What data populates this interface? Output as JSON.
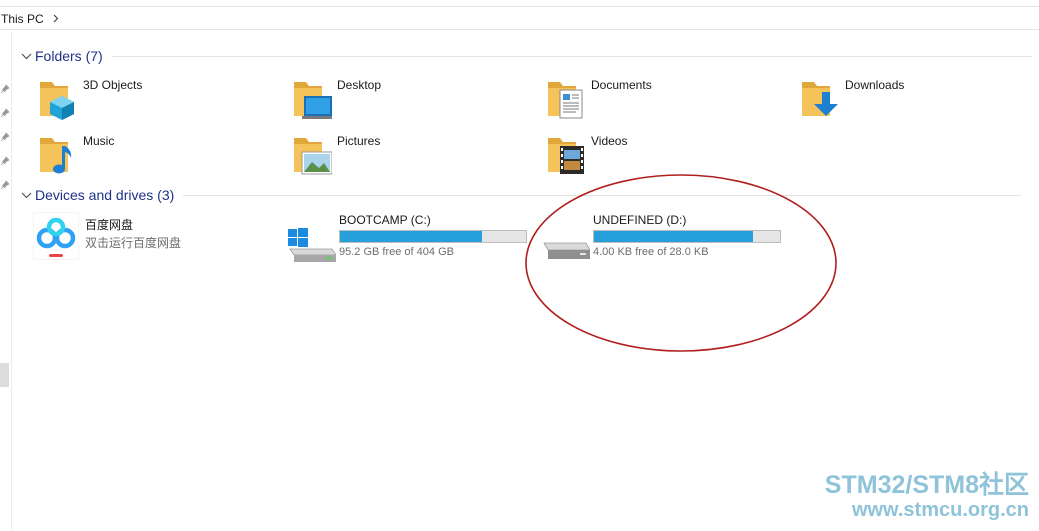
{
  "breadcrumb": {
    "location": "This PC"
  },
  "folders_group": {
    "title": "Folders (7)",
    "items": [
      {
        "label": "3D Objects",
        "icon": "3d-objects-folder-icon"
      },
      {
        "label": "Desktop",
        "icon": "desktop-folder-icon"
      },
      {
        "label": "Documents",
        "icon": "documents-folder-icon"
      },
      {
        "label": "Downloads",
        "icon": "downloads-folder-icon"
      },
      {
        "label": "Music",
        "icon": "music-folder-icon"
      },
      {
        "label": "Pictures",
        "icon": "pictures-folder-icon"
      },
      {
        "label": "Videos",
        "icon": "videos-folder-icon"
      }
    ]
  },
  "devices_group": {
    "title": "Devices and drives (3)",
    "baidu": {
      "name": "百度网盘",
      "subtitle": "双击运行百度网盘",
      "icon": "baidu-netdisk-icon"
    },
    "drives": [
      {
        "name": "BOOTCAMP (C:)",
        "free_text": "95.2 GB free of 404 GB",
        "used_fraction": 0.764,
        "icon": "windows-drive-icon"
      },
      {
        "name": "UNDEFINED (D:)",
        "free_text": "4.00 KB free of 28.0 KB",
        "used_fraction": 0.857,
        "icon": "drive-icon"
      }
    ]
  },
  "annotation": {
    "shape": "red-ellipse",
    "color": "#b01e1e",
    "highlights": "UNDEFINED (D:)"
  },
  "watermark": {
    "line1": "STM32/STM8社区",
    "line2": "www.stmcu.org.cn"
  },
  "colors": {
    "accent": "#26a0da",
    "group_title": "#1e3287",
    "folder": "#f4c35a"
  }
}
